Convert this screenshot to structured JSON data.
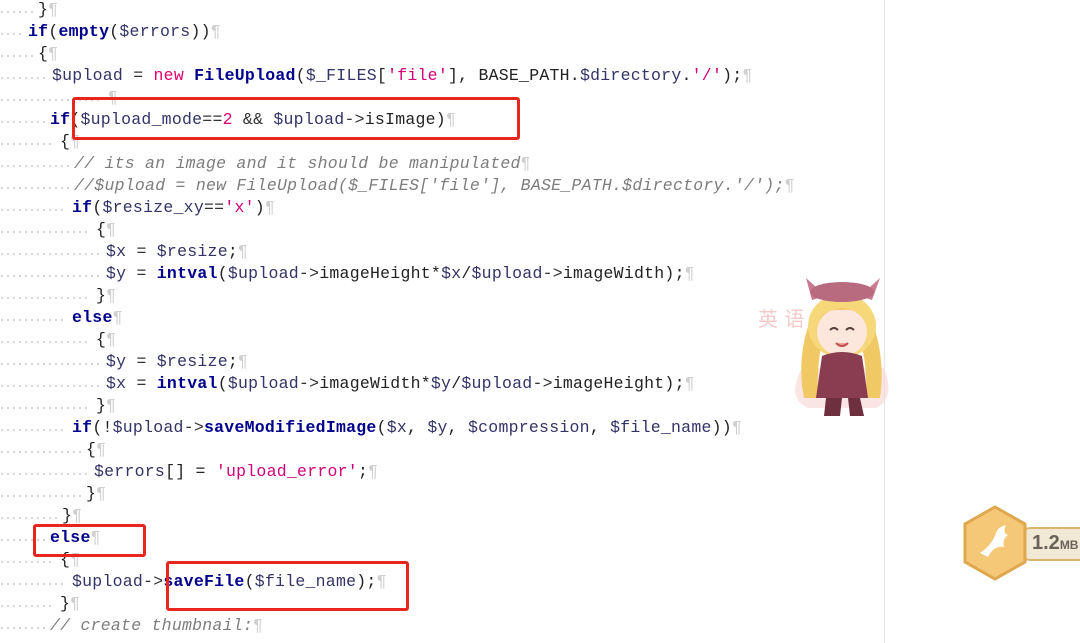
{
  "editor": {
    "lines": [
      {
        "indent": 38,
        "tokens": [
          [
            "pl",
            "}"
          ],
          [
            "pil",
            "¶"
          ]
        ]
      },
      {
        "indent": 28,
        "tokens": [
          [
            "kw",
            "if"
          ],
          [
            "pl",
            "("
          ],
          [
            "fn",
            "empty"
          ],
          [
            "pl",
            "("
          ],
          [
            "var",
            "$errors"
          ],
          [
            "pl",
            "))"
          ],
          [
            "pil",
            "¶"
          ]
        ]
      },
      {
        "indent": 38,
        "tokens": [
          [
            "pl",
            "{"
          ],
          [
            "pil",
            "¶"
          ]
        ]
      },
      {
        "indent": 52,
        "tokens": [
          [
            "var",
            "$upload"
          ],
          [
            "op",
            " = "
          ],
          [
            "new",
            "new"
          ],
          [
            "pl",
            " "
          ],
          [
            "fn",
            "FileUpload"
          ],
          [
            "pl",
            "("
          ],
          [
            "var",
            "$_FILES"
          ],
          [
            "pl",
            "["
          ],
          [
            "str",
            "'file'"
          ],
          [
            "pl",
            "], BASE_PATH."
          ],
          [
            "var",
            "$directory"
          ],
          [
            "pl",
            "."
          ],
          [
            "str",
            "'/'"
          ],
          [
            "pl",
            ");"
          ],
          [
            "pil",
            "¶"
          ]
        ]
      },
      {
        "indent": 108,
        "tokens": [
          [
            "pil",
            "¶"
          ]
        ]
      },
      {
        "indent": 50,
        "tokens": [
          [
            "kw",
            "if"
          ],
          [
            "pl",
            "("
          ],
          [
            "var",
            "$upload_mode"
          ],
          [
            "op",
            "=="
          ],
          [
            "num",
            "2"
          ],
          [
            "op",
            " && "
          ],
          [
            "var",
            "$upload"
          ],
          [
            "op",
            "->"
          ],
          [
            "pl",
            "isImage)"
          ],
          [
            "pil",
            "¶"
          ]
        ]
      },
      {
        "indent": 60,
        "tokens": [
          [
            "pl",
            "{"
          ],
          [
            "pil",
            "¶"
          ]
        ]
      },
      {
        "indent": 74,
        "tokens": [
          [
            "cm",
            "// its an image and it should be manipulated"
          ],
          [
            "pil",
            "¶"
          ]
        ]
      },
      {
        "indent": 74,
        "tokens": [
          [
            "cm",
            "//$upload = new FileUpload($_FILES['file'], BASE_PATH.$directory.'/');"
          ],
          [
            "pil",
            "¶"
          ]
        ]
      },
      {
        "indent": 72,
        "tokens": [
          [
            "kw",
            "if"
          ],
          [
            "pl",
            "("
          ],
          [
            "var",
            "$resize_xy"
          ],
          [
            "op",
            "=="
          ],
          [
            "str",
            "'x'"
          ],
          [
            "pl",
            ")"
          ],
          [
            "pil",
            "¶"
          ]
        ]
      },
      {
        "indent": 96,
        "tokens": [
          [
            "pl",
            "{"
          ],
          [
            "pil",
            "¶"
          ]
        ]
      },
      {
        "indent": 106,
        "tokens": [
          [
            "var",
            "$x"
          ],
          [
            "op",
            " = "
          ],
          [
            "var",
            "$resize"
          ],
          [
            "pl",
            ";"
          ],
          [
            "pil",
            "¶"
          ]
        ]
      },
      {
        "indent": 106,
        "tokens": [
          [
            "var",
            "$y"
          ],
          [
            "op",
            " = "
          ],
          [
            "fn",
            "intval"
          ],
          [
            "pl",
            "("
          ],
          [
            "var",
            "$upload"
          ],
          [
            "op",
            "->"
          ],
          [
            "pl",
            "imageHeight*"
          ],
          [
            "var",
            "$x"
          ],
          [
            "pl",
            "/"
          ],
          [
            "var",
            "$upload"
          ],
          [
            "op",
            "->"
          ],
          [
            "pl",
            "imageWidth);"
          ],
          [
            "pil",
            "¶"
          ]
        ]
      },
      {
        "indent": 96,
        "tokens": [
          [
            "pl",
            "}"
          ],
          [
            "pil",
            "¶"
          ]
        ]
      },
      {
        "indent": 72,
        "tokens": [
          [
            "kw",
            "else"
          ],
          [
            "pil",
            "¶"
          ]
        ]
      },
      {
        "indent": 96,
        "tokens": [
          [
            "pl",
            "{"
          ],
          [
            "pil",
            "¶"
          ]
        ]
      },
      {
        "indent": 106,
        "tokens": [
          [
            "var",
            "$y"
          ],
          [
            "op",
            " = "
          ],
          [
            "var",
            "$resize"
          ],
          [
            "pl",
            ";"
          ],
          [
            "pil",
            "¶"
          ]
        ]
      },
      {
        "indent": 106,
        "tokens": [
          [
            "var",
            "$x"
          ],
          [
            "op",
            " = "
          ],
          [
            "fn",
            "intval"
          ],
          [
            "pl",
            "("
          ],
          [
            "var",
            "$upload"
          ],
          [
            "op",
            "->"
          ],
          [
            "pl",
            "imageWidth*"
          ],
          [
            "var",
            "$y"
          ],
          [
            "pl",
            "/"
          ],
          [
            "var",
            "$upload"
          ],
          [
            "op",
            "->"
          ],
          [
            "pl",
            "imageHeight);"
          ],
          [
            "pil",
            "¶"
          ]
        ]
      },
      {
        "indent": 96,
        "tokens": [
          [
            "pl",
            "}"
          ],
          [
            "pil",
            "¶"
          ]
        ]
      },
      {
        "indent": 72,
        "tokens": [
          [
            "kw",
            "if"
          ],
          [
            "pl",
            "(!"
          ],
          [
            "var",
            "$upload"
          ],
          [
            "op",
            "->"
          ],
          [
            "fn",
            "saveModifiedImage"
          ],
          [
            "pl",
            "("
          ],
          [
            "var",
            "$x"
          ],
          [
            "pl",
            ", "
          ],
          [
            "var",
            "$y"
          ],
          [
            "pl",
            ", "
          ],
          [
            "var",
            "$compression"
          ],
          [
            "pl",
            ", "
          ],
          [
            "var",
            "$file_name"
          ],
          [
            "pl",
            "))"
          ],
          [
            "pil",
            "¶"
          ]
        ]
      },
      {
        "indent": 86,
        "tokens": [
          [
            "pl",
            "{"
          ],
          [
            "pil",
            "¶"
          ]
        ]
      },
      {
        "indent": 94,
        "tokens": [
          [
            "var",
            "$errors"
          ],
          [
            "pl",
            "[] = "
          ],
          [
            "str",
            "'upload_error'"
          ],
          [
            "pl",
            ";"
          ],
          [
            "pil",
            "¶"
          ]
        ]
      },
      {
        "indent": 86,
        "tokens": [
          [
            "pl",
            "}"
          ],
          [
            "pil",
            "¶"
          ]
        ]
      },
      {
        "indent": 62,
        "tokens": [
          [
            "pl",
            "}"
          ],
          [
            "pil",
            "¶"
          ]
        ]
      },
      {
        "indent": 50,
        "tokens": [
          [
            "kw",
            "else"
          ],
          [
            "pil",
            "¶"
          ]
        ]
      },
      {
        "indent": 60,
        "tokens": [
          [
            "pl",
            "{"
          ],
          [
            "pil",
            "¶"
          ]
        ]
      },
      {
        "indent": 72,
        "tokens": [
          [
            "var",
            "$upload"
          ],
          [
            "op",
            "->"
          ],
          [
            "fn",
            "saveFile"
          ],
          [
            "pl",
            "("
          ],
          [
            "var",
            "$file_name"
          ],
          [
            "pl",
            ");"
          ],
          [
            "pil",
            "¶"
          ]
        ]
      },
      {
        "indent": 60,
        "tokens": [
          [
            "pl",
            "}"
          ],
          [
            "pil",
            "¶"
          ]
        ]
      },
      {
        "indent": 50,
        "tokens": [
          [
            "cm",
            "// create thumbnail:"
          ],
          [
            "pil",
            "¶"
          ]
        ]
      }
    ],
    "highlights": [
      {
        "name": "highlight-if-upload-mode"
      },
      {
        "name": "highlight-else"
      },
      {
        "name": "highlight-savefile"
      }
    ]
  },
  "watermark": {
    "glyphs": "英 语 简"
  },
  "file_badge": {
    "size_number": "1.2",
    "size_unit": "MB",
    "icon": "bird-icon",
    "accent": "#e8b862"
  },
  "colors": {
    "keyword": "#00008b",
    "string": "#d0007a",
    "comment": "#7d7d7d",
    "highlight": "#e8261e"
  }
}
